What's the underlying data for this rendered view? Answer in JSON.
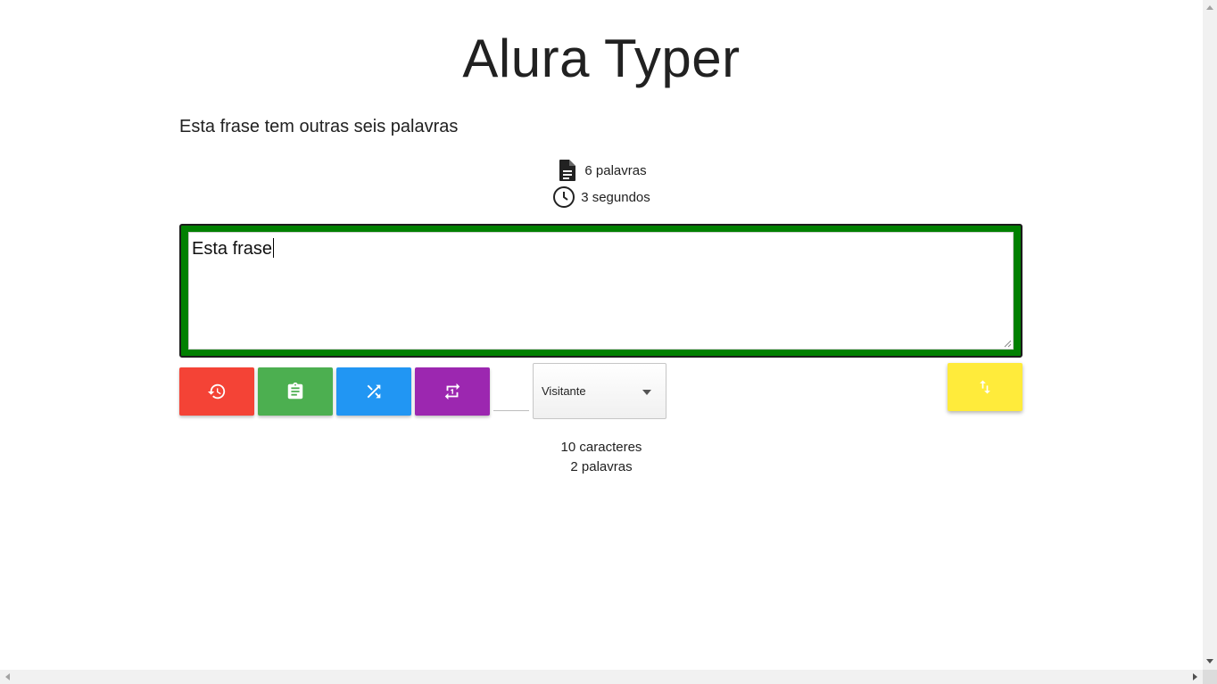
{
  "app": {
    "title": "Alura Typer",
    "phrase": "Esta frase tem outras seis palavras"
  },
  "stats": {
    "words": "6 palavras",
    "words_icon": "document-icon",
    "time": "3 segundos",
    "time_icon": "clock-icon"
  },
  "typing": {
    "value": "Esta frase",
    "border_color": "#008000"
  },
  "buttons": [
    {
      "name": "restart-button",
      "icon": "history-icon",
      "color": "#f44336"
    },
    {
      "name": "scoreboard-button",
      "icon": "clipboard-icon",
      "color": "#4caf50"
    },
    {
      "name": "random-phrase-button",
      "icon": "shuffle-icon",
      "color": "#2196f3"
    },
    {
      "name": "repeat-button",
      "icon": "repeat-icon",
      "color": "#9c27b0"
    },
    {
      "name": "sync-button",
      "icon": "swap-vertical-icon",
      "color": "#ffeb3b"
    }
  ],
  "user_select": {
    "selected": "Visitante"
  },
  "counters": {
    "characters": "10 caracteres",
    "words": "2 palavras"
  }
}
